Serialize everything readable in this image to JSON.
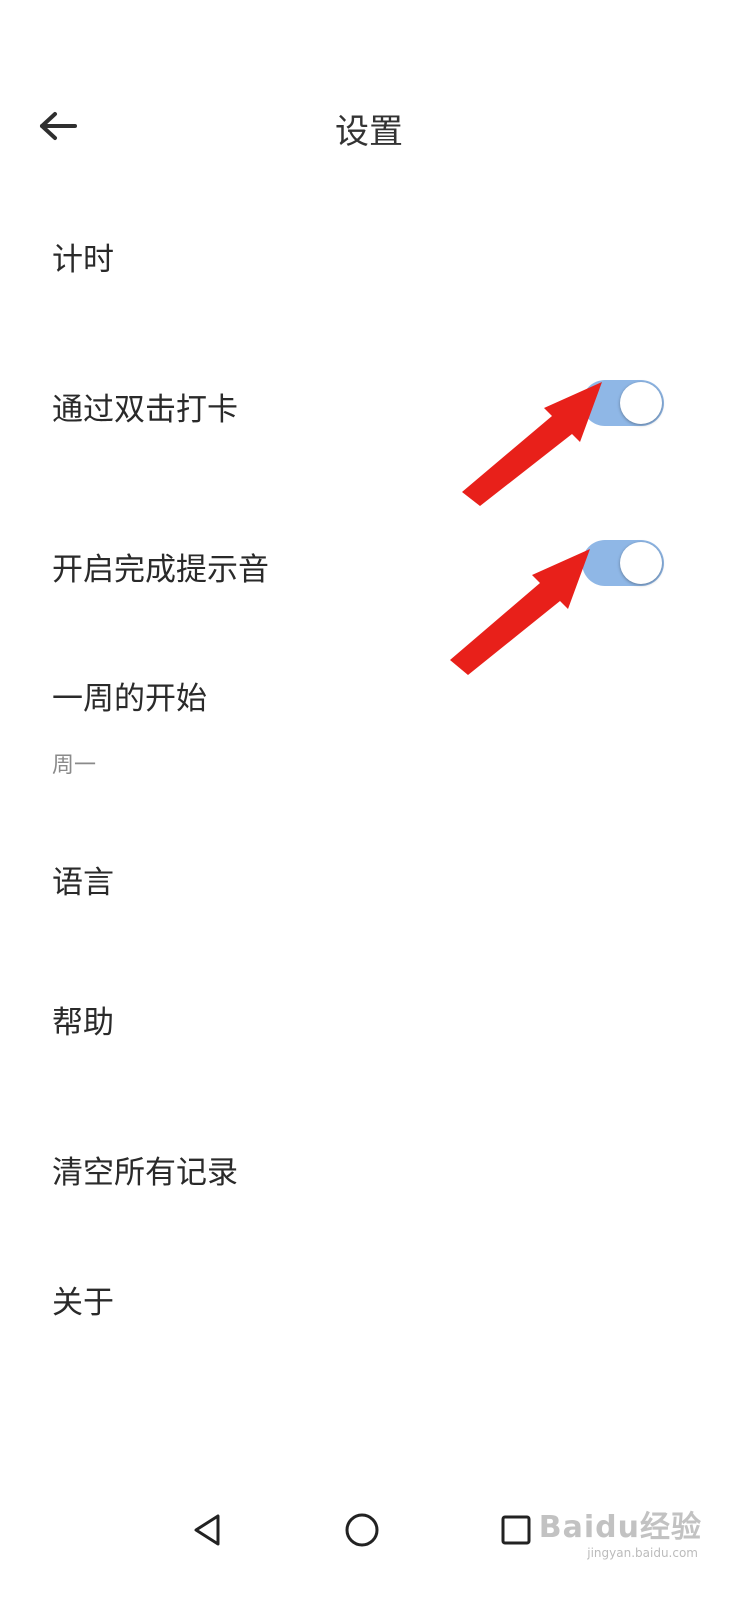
{
  "header": {
    "title": "设置",
    "back_icon": "arrow-left-icon"
  },
  "settings": {
    "timer": {
      "label": "计时"
    },
    "double_tap_checkin": {
      "label": "通过双击打卡",
      "enabled": true
    },
    "completion_sound": {
      "label": "开启完成提示音",
      "enabled": true
    },
    "week_start": {
      "label": "一周的开始",
      "value": "周一"
    },
    "language": {
      "label": "语言"
    },
    "help": {
      "label": "帮助"
    },
    "clear_records": {
      "label": "清空所有记录"
    },
    "about": {
      "label": "关于"
    }
  },
  "colors": {
    "switch_on_track": "#8fb7e6",
    "annotation_arrow": "#e8201a"
  },
  "nav": {
    "back_icon": "triangle-back-icon",
    "home_icon": "circle-home-icon",
    "recents_icon": "square-recents-icon"
  },
  "watermark": {
    "text": "Baidu经验",
    "sub": "jingyan.baidu.com"
  }
}
